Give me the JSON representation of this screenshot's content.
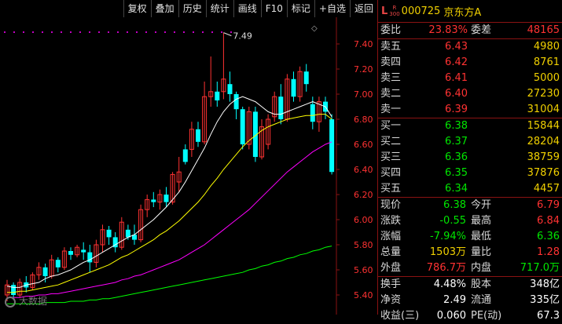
{
  "toolbar": {
    "buttons": [
      "复权",
      "叠加",
      "历史",
      "统计",
      "画线",
      "F10",
      "标记",
      "+自选",
      "返回"
    ]
  },
  "chart": {
    "ylabels": [
      "7.40",
      "7.20",
      "7.00",
      "6.80",
      "6.60",
      "6.40",
      "6.20",
      "6.00",
      "5.80",
      "5.60",
      "5.40"
    ],
    "yticks": [
      7.4,
      7.2,
      7.0,
      6.8,
      6.6,
      6.4,
      6.2,
      6.0,
      5.8,
      5.6,
      5.4
    ],
    "high_annotation": "7.49",
    "candles": [
      [
        5.4,
        5.48,
        5.35,
        5.52,
        0
      ],
      [
        5.48,
        5.4,
        5.36,
        5.5,
        1
      ],
      [
        5.4,
        5.5,
        5.38,
        5.53,
        0
      ],
      [
        5.5,
        5.46,
        5.42,
        5.55,
        1
      ],
      [
        5.46,
        5.56,
        5.44,
        5.58,
        0
      ],
      [
        5.56,
        5.62,
        5.52,
        5.66,
        0
      ],
      [
        5.62,
        5.55,
        5.5,
        5.65,
        1
      ],
      [
        5.55,
        5.68,
        5.53,
        5.72,
        0
      ],
      [
        5.68,
        5.62,
        5.58,
        5.7,
        1
      ],
      [
        5.62,
        5.75,
        5.6,
        5.78,
        0
      ],
      [
        5.75,
        5.72,
        5.68,
        5.78,
        1
      ],
      [
        5.72,
        5.78,
        5.7,
        5.8,
        0
      ],
      [
        5.76,
        5.74,
        5.68,
        5.82,
        1
      ],
      [
        5.74,
        5.66,
        5.58,
        5.8,
        1
      ],
      [
        5.66,
        5.8,
        5.62,
        5.84,
        0
      ],
      [
        5.8,
        5.92,
        5.74,
        5.96,
        0
      ],
      [
        5.92,
        5.86,
        5.8,
        5.95,
        1
      ],
      [
        5.86,
        5.78,
        5.74,
        5.9,
        1
      ],
      [
        5.78,
        5.98,
        5.76,
        6.02,
        0
      ],
      [
        5.92,
        5.86,
        5.84,
        5.96,
        1
      ],
      [
        5.88,
        5.84,
        5.8,
        5.96,
        1
      ],
      [
        5.84,
        6.08,
        5.82,
        6.12,
        0
      ],
      [
        6.08,
        6.16,
        6.02,
        6.2,
        0
      ],
      [
        6.16,
        6.14,
        6.1,
        6.22,
        1
      ],
      [
        6.14,
        6.2,
        6.08,
        6.24,
        0
      ],
      [
        6.2,
        6.14,
        6.1,
        6.26,
        1
      ],
      [
        6.14,
        6.36,
        6.12,
        6.38,
        0
      ],
      [
        6.3,
        6.38,
        6.22,
        6.5,
        0
      ],
      [
        6.46,
        6.56,
        6.44,
        6.6,
        1
      ],
      [
        6.56,
        6.72,
        6.5,
        6.78,
        0
      ],
      [
        6.72,
        6.62,
        6.58,
        6.78,
        1
      ],
      [
        6.62,
        6.98,
        6.6,
        7.1,
        0
      ],
      [
        6.98,
        7.02,
        6.9,
        7.3,
        0
      ],
      [
        7.02,
        6.95,
        6.9,
        7.1,
        1
      ],
      [
        7.02,
        7.12,
        6.96,
        7.49,
        0
      ],
      [
        7.08,
        7.0,
        6.94,
        7.18,
        1
      ],
      [
        7.0,
        6.88,
        6.8,
        7.02,
        1
      ],
      [
        6.88,
        6.6,
        6.56,
        6.9,
        1
      ],
      [
        6.6,
        6.86,
        6.56,
        6.9,
        0
      ],
      [
        6.86,
        6.5,
        6.46,
        6.9,
        1
      ],
      [
        6.5,
        6.74,
        6.48,
        6.8,
        0
      ],
      [
        6.6,
        6.8,
        6.56,
        6.84,
        0
      ],
      [
        6.82,
        6.98,
        6.78,
        7.02,
        0
      ],
      [
        6.98,
        6.8,
        6.76,
        7.08,
        1
      ],
      [
        6.8,
        7.12,
        6.78,
        7.16,
        0
      ],
      [
        7.12,
        6.98,
        6.94,
        7.18,
        1
      ],
      [
        6.98,
        7.18,
        6.94,
        7.22,
        0
      ],
      [
        7.18,
        7.08,
        7.02,
        7.24,
        1
      ],
      [
        6.92,
        6.78,
        6.72,
        6.98,
        1
      ],
      [
        6.78,
        6.94,
        6.7,
        6.98,
        0
      ],
      [
        6.94,
        6.86,
        6.8,
        6.98,
        1
      ],
      [
        6.8,
        6.38,
        6.36,
        6.84,
        1
      ]
    ],
    "ma5": [
      5.47,
      5.46,
      5.46,
      5.48,
      5.49,
      5.5,
      5.53,
      5.55,
      5.56,
      5.58,
      5.6,
      5.63,
      5.66,
      5.68,
      5.71,
      5.74,
      5.77,
      5.8,
      5.83,
      5.86,
      5.88,
      5.92,
      5.96,
      6.0,
      6.05,
      6.1,
      6.16,
      6.22,
      6.3,
      6.39,
      6.48,
      6.57,
      6.68,
      6.78,
      6.86,
      6.92,
      6.96,
      6.98,
      6.96,
      6.94,
      6.9,
      6.86,
      6.84,
      6.84,
      6.86,
      6.88,
      6.9,
      6.92,
      6.94,
      6.92,
      6.9,
      6.82
    ],
    "ma10": [
      5.42,
      5.42,
      5.43,
      5.43,
      5.44,
      5.45,
      5.46,
      5.47,
      5.48,
      5.5,
      5.52,
      5.54,
      5.56,
      5.58,
      5.6,
      5.62,
      5.64,
      5.67,
      5.7,
      5.72,
      5.75,
      5.78,
      5.81,
      5.84,
      5.88,
      5.91,
      5.95,
      5.99,
      6.04,
      6.09,
      6.14,
      6.2,
      6.27,
      6.33,
      6.4,
      6.46,
      6.52,
      6.58,
      6.63,
      6.67,
      6.71,
      6.74,
      6.76,
      6.78,
      6.8,
      6.81,
      6.82,
      6.83,
      6.83,
      6.84,
      6.84,
      6.8
    ],
    "ma20": [
      5.38,
      5.38,
      5.38,
      5.39,
      5.39,
      5.4,
      5.4,
      5.41,
      5.41,
      5.42,
      5.43,
      5.44,
      5.45,
      5.46,
      5.47,
      5.48,
      5.49,
      5.5,
      5.52,
      5.53,
      5.55,
      5.56,
      5.58,
      5.6,
      5.62,
      5.64,
      5.66,
      5.68,
      5.71,
      5.74,
      5.77,
      5.8,
      5.84,
      5.88,
      5.92,
      5.96,
      6.0,
      6.04,
      6.08,
      6.13,
      6.18,
      6.23,
      6.28,
      6.33,
      6.38,
      6.42,
      6.46,
      6.5,
      6.54,
      6.57,
      6.6,
      6.62
    ],
    "ma60": [
      5.33,
      5.33,
      5.33,
      5.33,
      5.33,
      5.33,
      5.34,
      5.34,
      5.34,
      5.34,
      5.35,
      5.35,
      5.35,
      5.36,
      5.36,
      5.37,
      5.37,
      5.38,
      5.39,
      5.4,
      5.41,
      5.42,
      5.43,
      5.44,
      5.45,
      5.46,
      5.47,
      5.48,
      5.49,
      5.5,
      5.51,
      5.52,
      5.53,
      5.54,
      5.55,
      5.56,
      5.57,
      5.58,
      5.6,
      5.61,
      5.63,
      5.64,
      5.66,
      5.67,
      5.69,
      5.7,
      5.72,
      5.73,
      5.75,
      5.76,
      5.78,
      5.79
    ],
    "colors": {
      "up": "#ff3232",
      "down": "#00ffff",
      "ma5": "#ffffff",
      "ma10": "#ffff00",
      "ma20": "#ff00ff",
      "ma60": "#00ff00",
      "axis": "#8a1212",
      "label": "#ff3232",
      "dots": "#ff00ff"
    }
  },
  "stock": {
    "l_mark": "L",
    "r_mark": "R",
    "r_sub": "300",
    "code": "000725",
    "name": "京东方A"
  },
  "weibi": {
    "label": "委比",
    "value": "23.83%",
    "label2": "委差",
    "value2": "48165"
  },
  "sell": [
    {
      "label": "卖五",
      "price": "6.43",
      "vol": "4980"
    },
    {
      "label": "卖四",
      "price": "6.42",
      "vol": "8761"
    },
    {
      "label": "卖三",
      "price": "6.41",
      "vol": "5000"
    },
    {
      "label": "卖二",
      "price": "6.40",
      "vol": "27230"
    },
    {
      "label": "卖一",
      "price": "6.39",
      "vol": "31004"
    }
  ],
  "buy": [
    {
      "label": "买一",
      "price": "6.38",
      "vol": "15844"
    },
    {
      "label": "买二",
      "price": "6.37",
      "vol": "28204"
    },
    {
      "label": "买三",
      "price": "6.36",
      "vol": "38759"
    },
    {
      "label": "买四",
      "price": "6.35",
      "vol": "37876"
    },
    {
      "label": "买五",
      "price": "6.34",
      "vol": "4457"
    }
  ],
  "quote": [
    {
      "l1": "现价",
      "v1": "6.38",
      "c1": "g",
      "l2": "今开",
      "v2": "6.79",
      "c2": "r"
    },
    {
      "l1": "涨跌",
      "v1": "-0.55",
      "c1": "g",
      "l2": "最高",
      "v2": "6.84",
      "c2": "r"
    },
    {
      "l1": "涨幅",
      "v1": "-7.94%",
      "c1": "g",
      "l2": "最低",
      "v2": "6.36",
      "c2": "g"
    },
    {
      "l1": "总量",
      "v1": "1503万",
      "c1": "y",
      "l2": "量比",
      "v2": "1.28",
      "c2": "r"
    },
    {
      "l1": "外盘",
      "v1": "786.7万",
      "c1": "r",
      "l2": "内盘",
      "v2": "717.0万",
      "c2": "g"
    }
  ],
  "fund": [
    {
      "l1": "换手",
      "v1": "4.48%",
      "l2": "股本",
      "v2": "348亿"
    },
    {
      "l1": "净资",
      "v1": "2.49",
      "l2": "流通",
      "v2": "335亿"
    },
    {
      "l1": "收益(三)",
      "v1": "0.060",
      "l2": "PE(动)",
      "v2": "67.3"
    }
  ],
  "watermark": "大数据"
}
